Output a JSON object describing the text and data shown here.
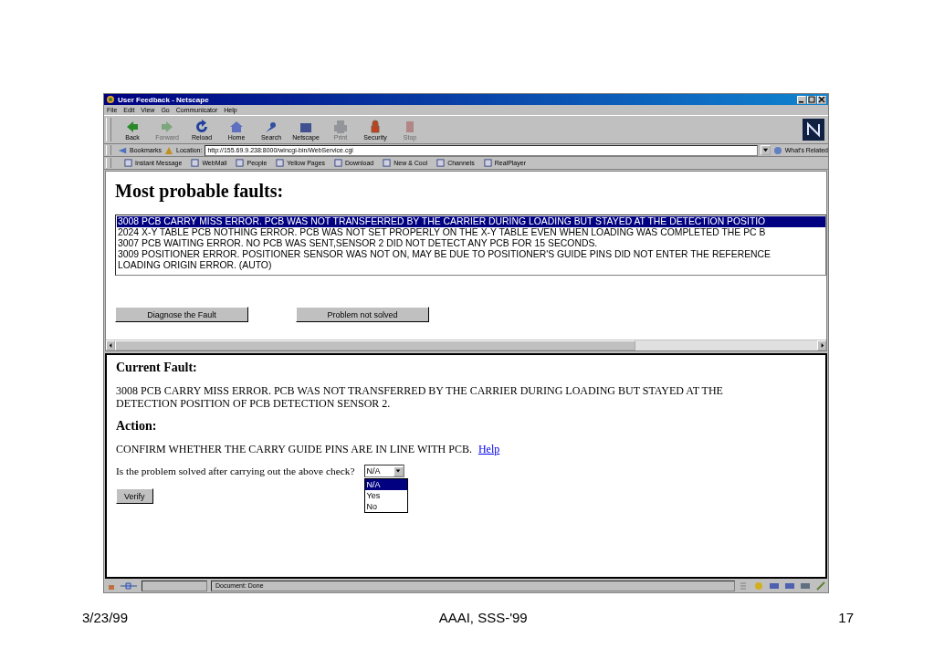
{
  "window": {
    "title": "User Feedback - Netscape"
  },
  "menu": [
    "File",
    "Edit",
    "View",
    "Go",
    "Communicator",
    "Help"
  ],
  "toolbar": [
    {
      "label": "Back",
      "disabled": false
    },
    {
      "label": "Forward",
      "disabled": true
    },
    {
      "label": "Reload",
      "disabled": false
    },
    {
      "label": "Home",
      "disabled": false
    },
    {
      "label": "Search",
      "disabled": false
    },
    {
      "label": "Netscape",
      "disabled": false
    },
    {
      "label": "Print",
      "disabled": true
    },
    {
      "label": "Security",
      "disabled": false
    },
    {
      "label": "Stop",
      "disabled": true
    }
  ],
  "location_bar": {
    "bookmarks": "Bookmarks",
    "label": "Location:",
    "url": "http://155.69.9.238:8000/wincgi-bin/WebService.cgi",
    "whats_related": "What's Related"
  },
  "personal_toolbar": [
    "Instant Message",
    "WebMail",
    "People",
    "Yellow Pages",
    "Download",
    "New & Cool",
    "Channels",
    "RealPlayer"
  ],
  "top_frame": {
    "heading": "Most probable faults:",
    "faults": [
      {
        "text": "3008 PCB CARRY MISS ERROR. PCB WAS NOT TRANSFERRED BY THE CARRIER DURING LOADING BUT STAYED AT THE DETECTION POSITIO",
        "selected": true
      },
      {
        "text": "2024 X-Y TABLE PCB NOTHING ERROR. PCB WAS NOT SET PROPERLY ON THE X-Y TABLE EVEN WHEN LOADING WAS COMPLETED THE PC B",
        "selected": false
      },
      {
        "text": "3007 PCB WAITING ERROR. NO PCB WAS SENT,SENSOR 2 DID NOT DETECT ANY PCB FOR 15 SECONDS.",
        "selected": false
      },
      {
        "text": "3009 POSITIONER ERROR. POSITIONER SENSOR WAS NOT ON, MAY BE DUE TO POSITIONER'S GUIDE PINS DID NOT ENTER THE REFERENCE",
        "selected": false
      },
      {
        "text": "LOADING ORIGIN ERROR. (AUTO)",
        "selected": false
      }
    ],
    "buttons": [
      "Diagnose the Fault",
      "Problem not solved"
    ]
  },
  "bottom_frame": {
    "current_heading": "Current Fault:",
    "current_text": "3008 PCB CARRY MISS ERROR. PCB WAS NOT TRANSFERRED BY THE CARRIER DURING LOADING BUT STAYED AT THE DETECTION POSITION OF PCB DETECTION SENSOR 2.",
    "action_heading": "Action:",
    "action_text": "CONFIRM WHETHER THE CARRY GUIDE PINS ARE IN LINE WITH PCB.",
    "help_link": "Help",
    "question": "Is the problem solved after carrying out the above check?",
    "select_value": "N/A",
    "options": [
      {
        "label": "N/A",
        "selected": true
      },
      {
        "label": "Yes",
        "selected": false
      },
      {
        "label": "No",
        "selected": false
      }
    ],
    "verify_button": "Verify"
  },
  "status_bar": {
    "text": "Document: Done"
  },
  "footer": {
    "date": "3/23/99",
    "conference": "AAAI, SSS-'99",
    "page": "17"
  }
}
